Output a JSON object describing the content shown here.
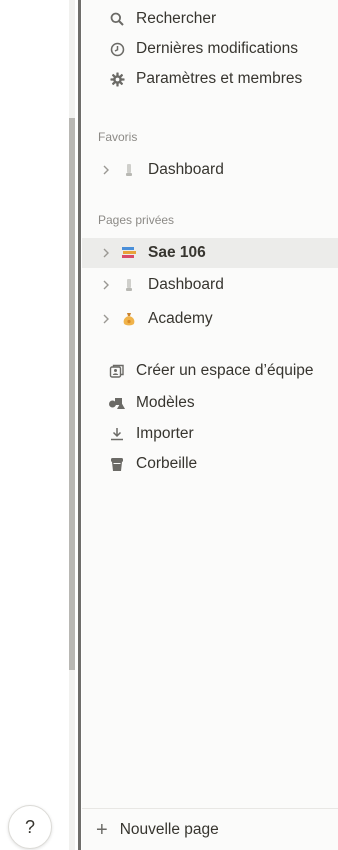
{
  "top_nav": [
    {
      "label": "Rechercher",
      "icon": "search-icon"
    },
    {
      "label": "Dernières modifications",
      "icon": "clock-icon"
    },
    {
      "label": "Paramètres et membres",
      "icon": "gear-icon"
    }
  ],
  "favorites": {
    "label": "Favoris",
    "items": [
      {
        "label": "Dashboard",
        "icon": "dashboard-page-icon"
      }
    ]
  },
  "private_pages": {
    "label": "Pages privées",
    "items": [
      {
        "label": "Sae 106",
        "icon": "books-page-icon",
        "active": true
      },
      {
        "label": "Dashboard",
        "icon": "dashboard-page-icon"
      },
      {
        "label": "Academy",
        "icon": "money-bag-page-icon"
      }
    ]
  },
  "tools": [
    {
      "label": "Créer un espace d’équipe",
      "icon": "team-space-icon"
    },
    {
      "label": "Modèles",
      "icon": "templates-icon"
    },
    {
      "label": "Importer",
      "icon": "import-icon"
    },
    {
      "label": "Corbeille",
      "icon": "trash-icon"
    }
  ],
  "bottom": {
    "new_page_label": "Nouvelle page",
    "plus": "+"
  },
  "help": {
    "label": "?"
  },
  "colors": {
    "sidebar_bg": "#fbfbfa",
    "active_bg": "#ececea",
    "text": "#37352f"
  }
}
